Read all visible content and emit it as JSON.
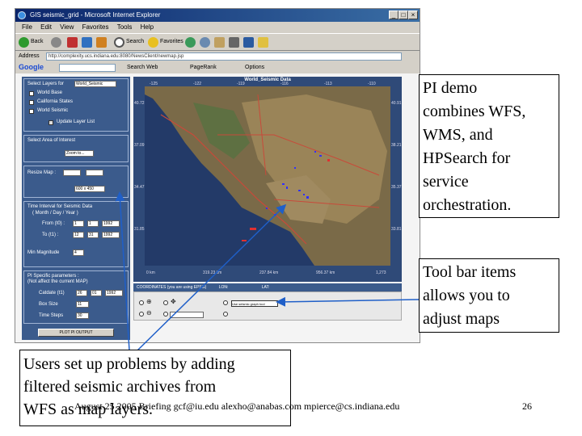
{
  "browser": {
    "title": "GIS seismic_grid - Microsoft Internet Explorer",
    "menu": [
      "File",
      "Edit",
      "View",
      "Favorites",
      "Tools",
      "Help"
    ],
    "toolbar": {
      "back": "Back",
      "search": "Search",
      "favorites": "Favorites"
    },
    "address_label": "Address",
    "address": "http://complexity.ucs.indiana.edu:8080/NewsClient/newmap.jsp",
    "google_logo": "Google",
    "google_items": {
      "search_web": "Search Web",
      "pagerank": "PageRank",
      "options": "Options"
    }
  },
  "left_panel": {
    "select_layers": "Select Layers for",
    "layer_select_value": "World_Seismic",
    "layers": [
      "World Base",
      "California States",
      "World Seismic"
    ],
    "update_btn": "Update Layer List",
    "area_label": "Select Area of Interest",
    "zoom_value": "Zoom to...",
    "resize_label": "Resize Map :",
    "resize_value": "600 x 450",
    "time_label": "Time Interval for Seismic Data",
    "time_sub": "( Month / Day / Year )",
    "from_label": "From (t0) :",
    "from_values": [
      "1",
      "1",
      "1992"
    ],
    "to_label": "To (t1) :",
    "to_values": [
      "12",
      "31",
      "1992"
    ],
    "min_mag_label": "Min Magnitude",
    "min_mag_value": "4",
    "pi_label": "PI Specific parameters :",
    "pi_sub": "(Not affect the current MAP)",
    "catdate_label": "Catdate (t1)",
    "catdate_values": [
      "26",
      "01",
      "1992"
    ],
    "box_size_label": "Box Size",
    "box_size_value": "11",
    "time_steps_label": "Time Steps",
    "time_steps_value": "30",
    "plot_btn": "PLOT PI OUTPUT"
  },
  "map": {
    "title": "World_Seismic Data",
    "top_ticks": [
      "-125",
      "-122",
      "-119",
      "-116",
      "-113",
      "-110"
    ],
    "left_ticks": [
      "40.72",
      "37.09",
      "34.47",
      "31.85"
    ],
    "right_ticks": [
      "40.91",
      "38.21",
      "35.37",
      "33.81"
    ],
    "bottom_labels": [
      "0 km",
      "319.23 km",
      "237.84 km",
      "956.37 km",
      "1,273"
    ],
    "coord_labels": [
      "COORDINATES (you are using EPSG)",
      "LON:",
      "LAT:"
    ],
    "tool_input": "Use seismic graph tool"
  },
  "callouts": {
    "pi_demo": [
      "PI demo",
      "combines WFS,",
      "WMS, and",
      "HPSearch for",
      "service",
      "orchestration."
    ],
    "toolbar": [
      "Tool bar items",
      "allows you to",
      "adjust maps"
    ],
    "users": [
      "Users set up problems by adding",
      "filtered seismic archives from",
      "WFS as map layers."
    ]
  },
  "footer": "August 25 2005 Briefing   gcf@iu.edu  alexho@anabas.com mpierce@cs.indiana.edu",
  "slide_number": "26",
  "colors": {
    "panel": "#3b5b8c",
    "titlebar": "#0a246a",
    "arrow": "#1f5fc8"
  }
}
